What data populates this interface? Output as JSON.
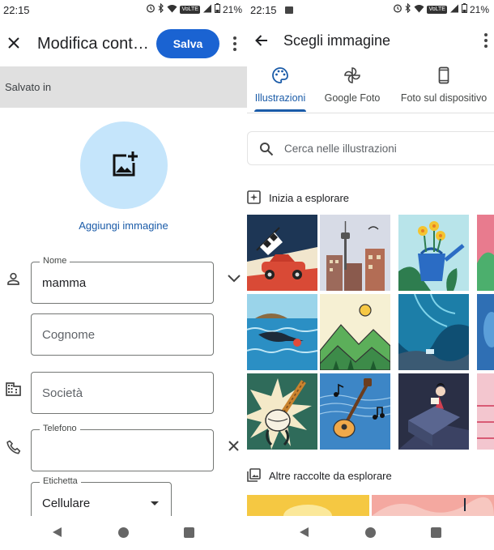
{
  "left": {
    "status": {
      "time": "22:15",
      "battery": "21%",
      "volte": "VoLTE"
    },
    "toolbar": {
      "title": "Modifica cont…",
      "save_label": "Salva"
    },
    "saved_in_label": "Salvato in",
    "add_image_label": "Aggiungi immagine",
    "fields": {
      "name": {
        "label": "Nome",
        "value": "mamma"
      },
      "surname": {
        "placeholder": "Cognome"
      },
      "company": {
        "placeholder": "Società"
      },
      "phone": {
        "label": "Telefono",
        "value": ""
      },
      "tag": {
        "label": "Etichetta",
        "value": "Cellulare"
      }
    },
    "icons": [
      "close-icon",
      "more-vert-icon",
      "add-photo-icon",
      "person-icon",
      "expand-more-icon",
      "business-icon",
      "phone-icon",
      "clear-icon",
      "dropdown-arrow-icon"
    ]
  },
  "right": {
    "status": {
      "time": "22:15",
      "battery": "21%",
      "volte": "VoLTE"
    },
    "title": "Scegli immagine",
    "tabs": [
      {
        "label": "Illustrazioni",
        "icon": "palette-icon",
        "active": true
      },
      {
        "label": "Google Foto",
        "icon": "pinwheel-icon",
        "active": false
      },
      {
        "label": "Foto sul dispositivo",
        "icon": "smartphone-icon",
        "active": false
      }
    ],
    "search": {
      "placeholder": "Cerca nelle illustrazioni"
    },
    "section_explore": "Inizia a esplorare",
    "section_more": "Altre raccolte da esplorare",
    "illustrations": [
      "racing-car-checkered-flag",
      "city-tower-skyline",
      "blue-watering-can-flowers",
      "swimmer-in-sea",
      "green-hills-sun",
      "underwater-blue-cave",
      "badminton-shuttlecock",
      "acoustic-guitar-notes",
      "person-reading-sofa"
    ]
  },
  "colors": {
    "accent": "#1a63d2",
    "link": "#1a5ba8",
    "avatar_bg": "#c5e5fb",
    "saved_band": "#e0e0e0"
  }
}
